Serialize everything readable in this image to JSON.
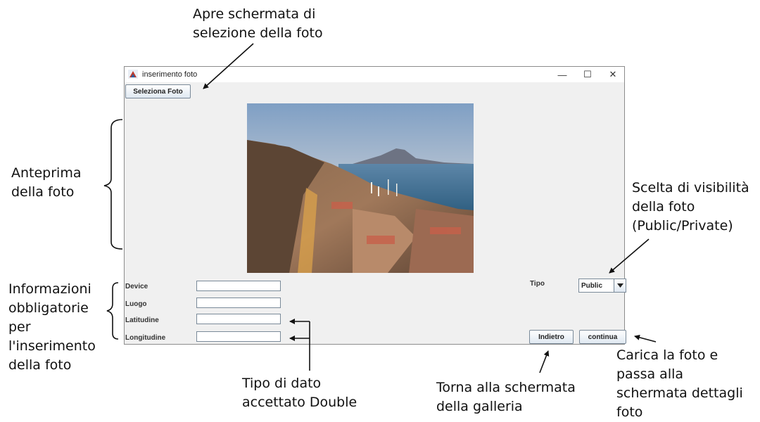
{
  "annotations": {
    "select_photo": "Apre schermata di\nselezione della foto",
    "preview": "Anteprima\ndella foto",
    "visibility": "Scelta di visibilità\ndella foto\n(Public/Private)",
    "required_info": "Informazioni\nobbligatorie\nper\nl'inserimento\ndella foto",
    "double_type": "Tipo di dato\naccettato Double",
    "back": "Torna alla schermata\ndella galleria",
    "continue": "Carica la foto e\npassa alla\nschermata dettagli\nfoto"
  },
  "window": {
    "title": "inserimento foto",
    "controls": {
      "minimize": "—",
      "maximize": "☐",
      "close": "✕"
    },
    "select_button": "Seleziona Foto",
    "fields": [
      {
        "label": "Device",
        "value": ""
      },
      {
        "label": "Luogo",
        "value": ""
      },
      {
        "label": "Latitudine",
        "value": ""
      },
      {
        "label": "Longitudine",
        "value": ""
      }
    ],
    "tipo_label": "Tipo",
    "tipo_selected": "Public",
    "back_button": "Indietro",
    "continue_button": "continua"
  },
  "icons": {
    "app": "java-app-icon",
    "combo_arrow": "caret-down-icon",
    "photo": "naples-bay-photo"
  }
}
